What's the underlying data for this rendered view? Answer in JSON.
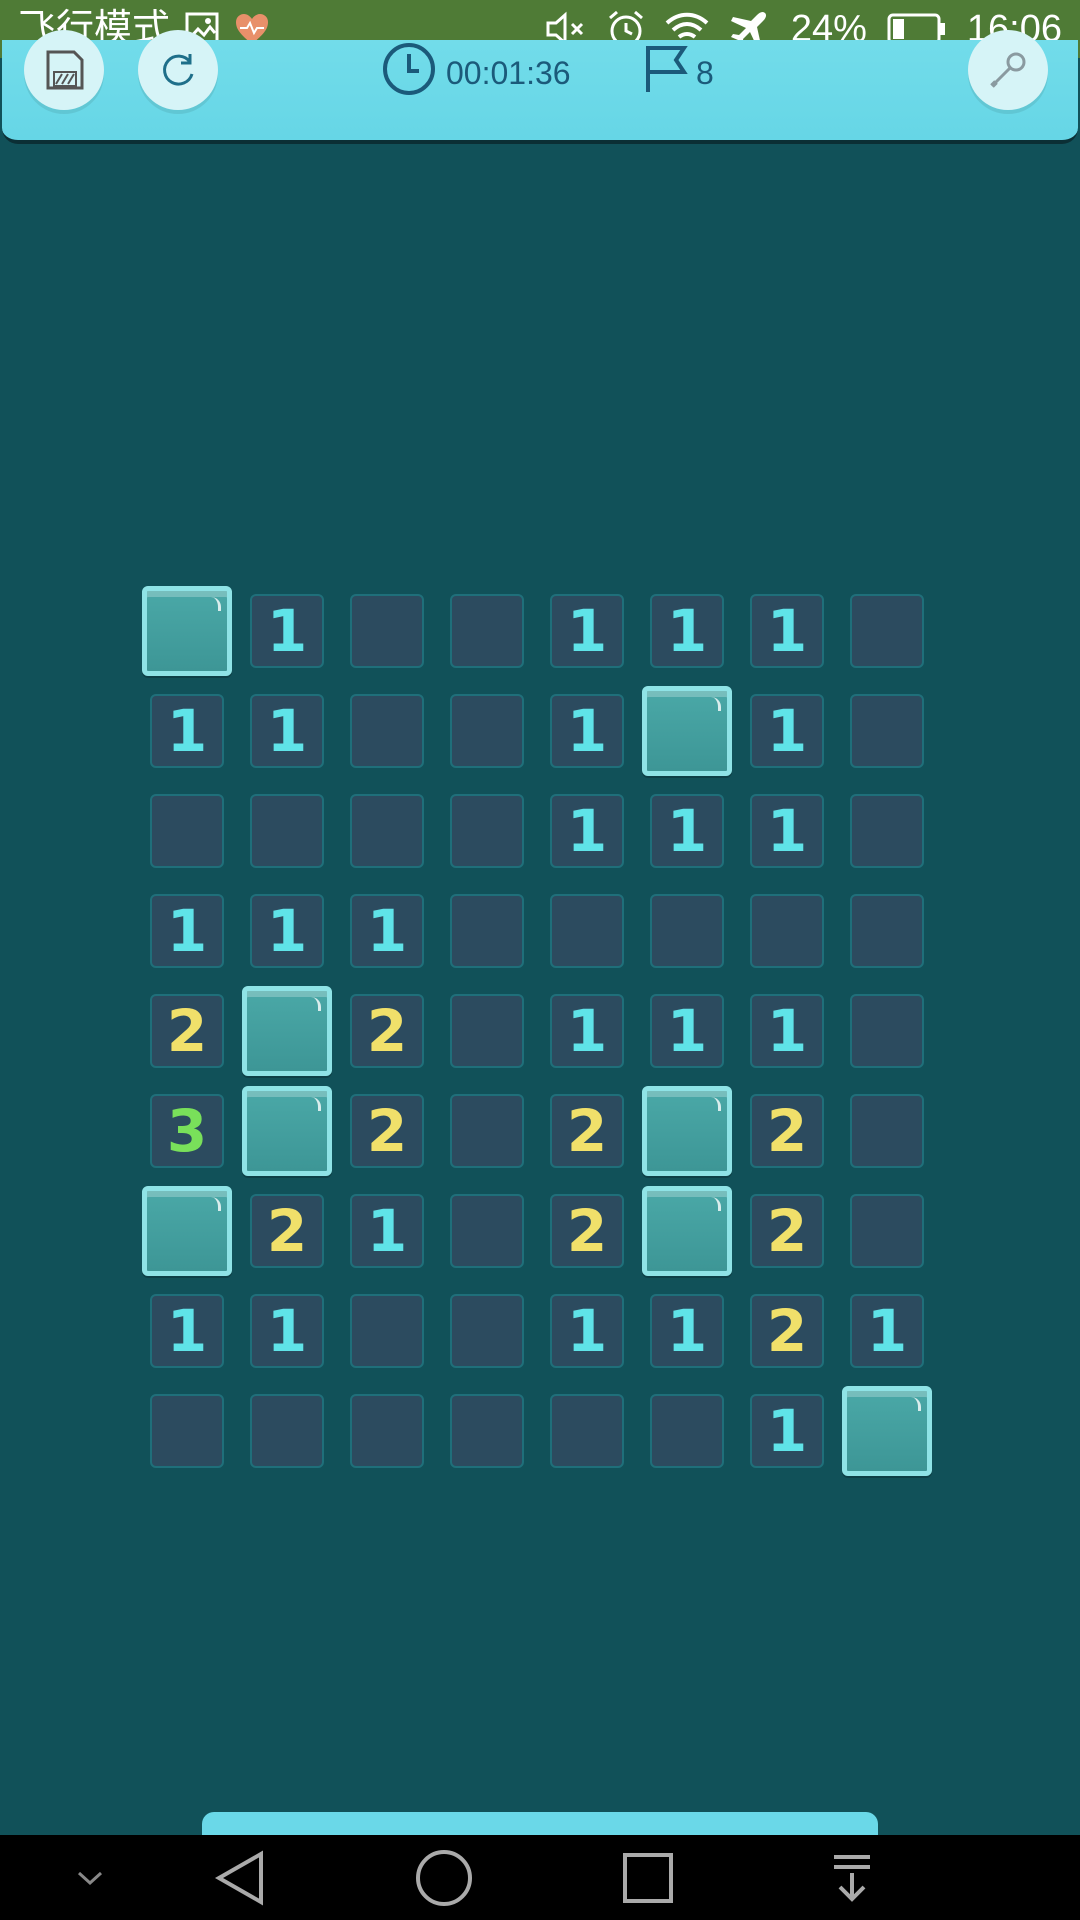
{
  "status_bar": {
    "airplane_mode_label": "飞行模式",
    "battery_percent": "24%",
    "time": "16:06",
    "icons": [
      "image-icon",
      "heart-pulse-icon",
      "mute-icon",
      "alarm-icon",
      "wifi-icon",
      "airplane-icon",
      "battery-icon"
    ]
  },
  "top_bar": {
    "timer": "00:01:36",
    "flag_count": "8",
    "icons": [
      "save-icon",
      "restart-icon",
      "clock-icon",
      "flag-icon",
      "settings-icon"
    ]
  },
  "board": {
    "rows": 9,
    "cols": 8,
    "cells": [
      [
        "C",
        "1",
        "",
        "",
        "1",
        "1",
        "1",
        ""
      ],
      [
        "1",
        "1",
        "",
        "",
        "1",
        "C",
        "1",
        ""
      ],
      [
        "",
        "",
        "",
        "",
        "1",
        "1",
        "1",
        ""
      ],
      [
        "1",
        "1",
        "1",
        "",
        "",
        "",
        "",
        ""
      ],
      [
        "2",
        "C",
        "2",
        "",
        "1",
        "1",
        "1",
        ""
      ],
      [
        "3",
        "C",
        "2",
        "",
        "2",
        "C",
        "2",
        ""
      ],
      [
        "C",
        "2",
        "1",
        "",
        "2",
        "C",
        "2",
        ""
      ],
      [
        "1",
        "1",
        "",
        "",
        "1",
        "1",
        "2",
        "1"
      ],
      [
        "",
        "",
        "",
        "",
        "",
        "",
        "1",
        "C"
      ]
    ],
    "legend": {
      "C": "covered",
      "": "revealed-empty"
    },
    "colors": {
      "background": "#115159",
      "open_cell": "#2c4b5f",
      "covered_cell": "#4aa8a7",
      "number_1": "#5fe3e8",
      "number_2": "#f0e06a",
      "number_3": "#79e05a"
    }
  },
  "nav_bar": {
    "icons": [
      "chevron-down-icon",
      "back-icon",
      "home-icon",
      "recents-icon",
      "notification-pull-icon"
    ]
  }
}
